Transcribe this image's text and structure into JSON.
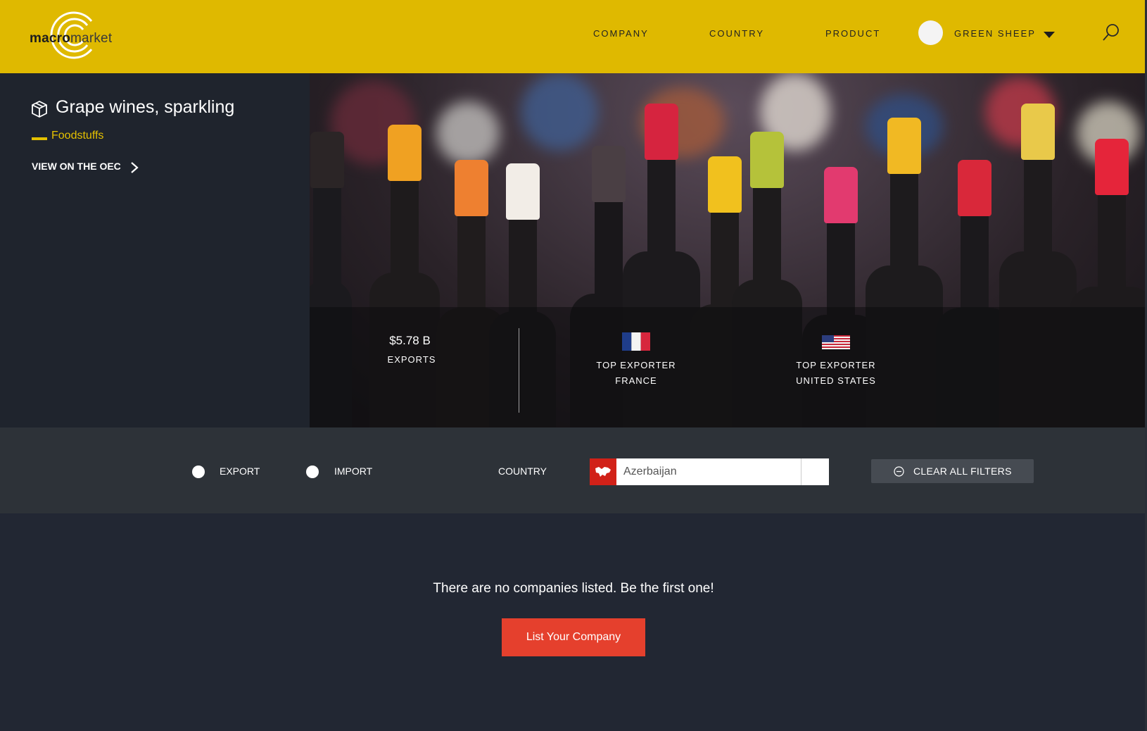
{
  "header": {
    "logo": {
      "bold": "macro",
      "light": "market"
    },
    "nav": [
      "COMPANY",
      "COUNTRY",
      "PRODUCT"
    ],
    "user_name": "GREEN SHEEP"
  },
  "product": {
    "title": "Grape wines, sparkling",
    "category": "Foodstuffs",
    "oec_link": "VIEW ON THE OEC"
  },
  "stats": {
    "exports_value": "$5.78 B",
    "exports_label": "EXPORTS",
    "top_exporter_label": "TOP EXPORTER",
    "top_exporter_1": "FRANCE",
    "top_exporter_2": "UNITED STATES"
  },
  "filters": {
    "export_label": "EXPORT",
    "import_label": "IMPORT",
    "country_label": "COUNTRY",
    "country_value": "Azerbaijan",
    "clear_label": "CLEAR ALL FILTERS"
  },
  "main": {
    "empty_message": "There are no companies listed. Be the first one!",
    "list_button": "List Your Company"
  },
  "colors": {
    "header_bg": "#dfb900",
    "accent_yellow": "#e5c100",
    "cta_red": "#e5402d",
    "panel_dark": "#1f242d"
  }
}
